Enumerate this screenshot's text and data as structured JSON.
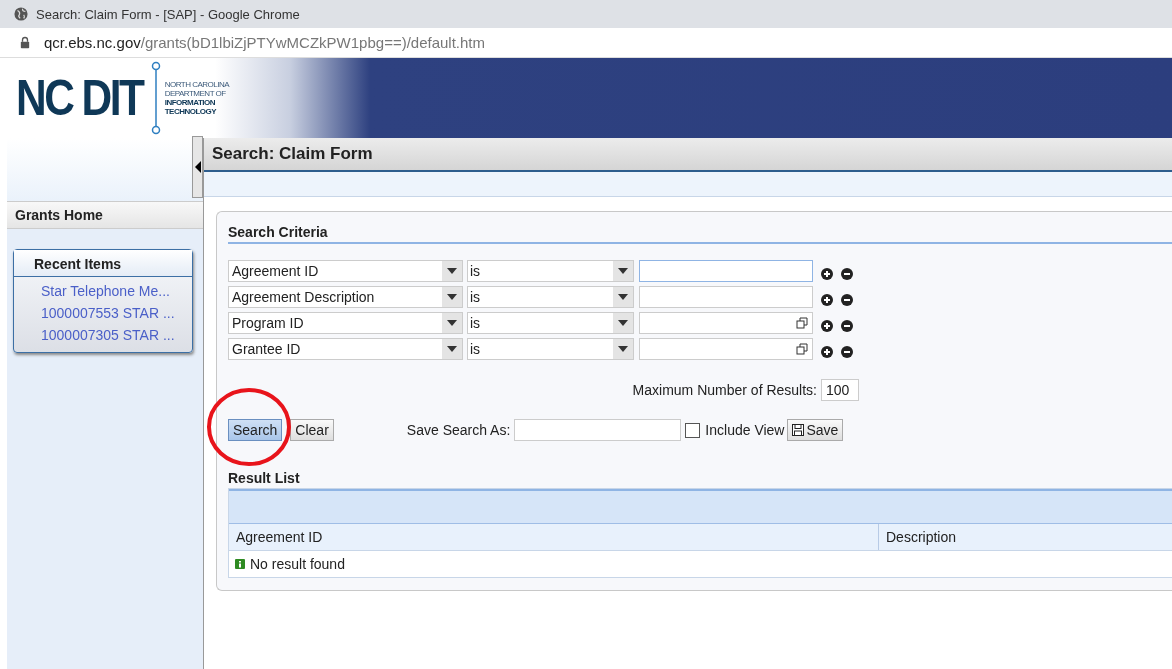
{
  "browser": {
    "title": "Search: Claim Form - [SAP] - Google Chrome",
    "url_host": "qcr.ebs.nc.gov",
    "url_path": "/grants(bD1lbiZjPTYwMCZkPW1pbg==)/default.htm"
  },
  "logo": {
    "mark": "NC DIT",
    "lines": [
      "NORTH CAROLINA",
      "DEPARTMENT OF",
      "INFORMATION",
      "TECHNOLOGY"
    ]
  },
  "sidebar": {
    "home": "Grants Home",
    "recent_title": "Recent Items",
    "recent_items": [
      "Star Telephone Me...",
      "1000007553 STAR ...",
      "1000007305 STAR ..."
    ]
  },
  "page_title": "Search: Claim Form",
  "search_criteria": {
    "title": "Search Criteria",
    "rows": [
      {
        "field": "Agreement ID",
        "operator": "is",
        "value_help": false,
        "focused": true
      },
      {
        "field": "Agreement Description",
        "operator": "is",
        "value_help": false,
        "focused": false
      },
      {
        "field": "Program ID",
        "operator": "is",
        "value_help": true,
        "focused": false
      },
      {
        "field": "Grantee ID",
        "operator": "is",
        "value_help": true,
        "focused": false
      }
    ],
    "max_results_label": "Maximum Number of Results:",
    "max_results": "100",
    "search_button": "Search",
    "clear_button": "Clear",
    "save_as_label": "Save Search As:",
    "include_view_label": "Include View",
    "include_view": false,
    "save_button": "Save",
    "search_highlighted": true
  },
  "result_list": {
    "title": "Result List",
    "columns": [
      "Agreement ID",
      "Description"
    ],
    "message": "No result found"
  }
}
